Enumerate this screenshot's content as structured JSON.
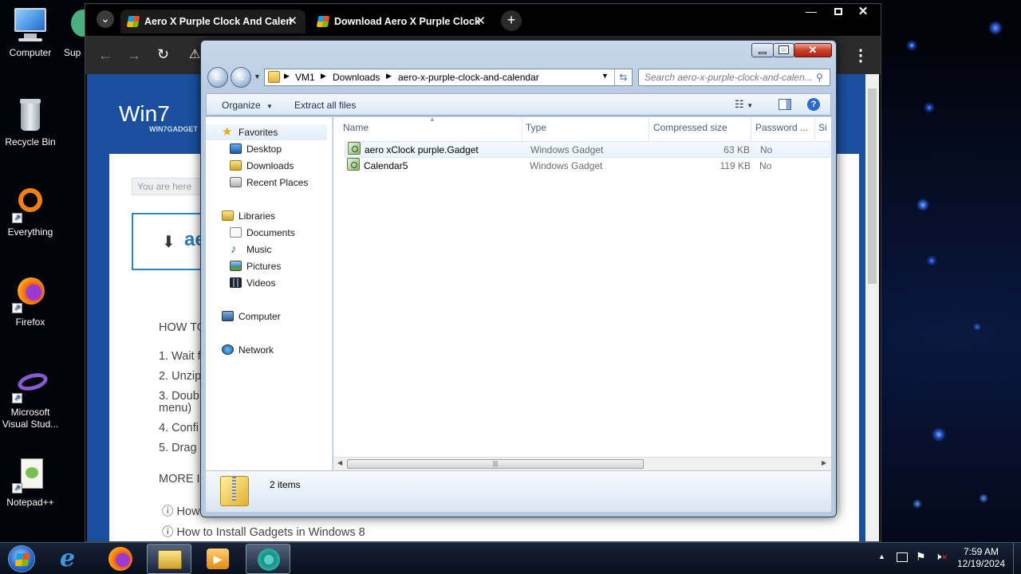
{
  "desktop": {
    "icons": [
      {
        "label": "Computer",
        "icon": "computer-icon"
      },
      {
        "label": "Recycle Bin",
        "icon": "recycle-bin-icon"
      },
      {
        "label": "Everything",
        "icon": "everything-icon"
      },
      {
        "label": "Firefox",
        "icon": "firefox-icon"
      },
      {
        "label": "Microsoft Visual Stud...",
        "icon": "visual-studio-icon"
      },
      {
        "label": "Notepad++",
        "icon": "notepadpp-icon"
      }
    ],
    "partial_icon_label": "Sup"
  },
  "browser": {
    "tabs": [
      {
        "title": "Aero X Purple Clock And Calen",
        "active": true
      },
      {
        "title": "Download Aero X Purple Clock",
        "active": false
      }
    ],
    "close_glyph": "✕",
    "new_tab_glyph": "+",
    "tab_list_glyph": "⌄",
    "menu_glyph": "⋮",
    "page": {
      "logo_text": "Win7",
      "logo_sub": "WIN7GADGET",
      "breadcrumb": "You are here",
      "download_text": "ae",
      "howto_heading": "HOW TO",
      "steps": [
        "1. Wait f",
        "2. Unzip",
        "3. Doub",
        "menu)",
        "4. Confi",
        "5. Drag"
      ],
      "more_heading": "MORE IN",
      "links": [
        "How",
        "How to Install Gadgets in Windows 8"
      ]
    }
  },
  "explorer": {
    "address_parts": [
      "VM1",
      "Downloads",
      "aero-x-purple-clock-and-calendar"
    ],
    "search_placeholder": "Search aero-x-purple-clock-and-calen...",
    "toolbar": {
      "organize": "Organize",
      "extract_all": "Extract all files"
    },
    "nav": {
      "favorites": "Favorites",
      "favorites_items": [
        "Desktop",
        "Downloads",
        "Recent Places"
      ],
      "libraries": "Libraries",
      "libraries_items": [
        "Documents",
        "Music",
        "Pictures",
        "Videos"
      ],
      "computer": "Computer",
      "network": "Network"
    },
    "columns": [
      "Name",
      "Type",
      "Compressed size",
      "Password ...",
      "Si"
    ],
    "files": [
      {
        "name": "aero xClock purple.Gadget",
        "type": "Windows Gadget",
        "size": "63 KB",
        "password": "No"
      },
      {
        "name": "Calendar5",
        "type": "Windows Gadget",
        "size": "119 KB",
        "password": "No"
      }
    ],
    "status": "2 items",
    "scroll_grip": "|||"
  },
  "taskbar": {
    "pinned": [
      "start-orb-icon",
      "internet-explorer-icon",
      "firefox-icon",
      "file-explorer-icon",
      "media-player-icon",
      "chrome-icon"
    ],
    "time": "7:59 AM",
    "date": "12/19/2024",
    "tray_glyph": "▲"
  },
  "colors": {
    "page_blue": "#1a4f9e",
    "close_red": "#c8402a",
    "desktop_bg": "#02040c"
  }
}
